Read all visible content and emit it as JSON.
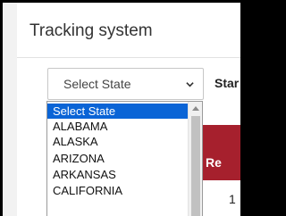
{
  "page": {
    "title": "Tracking system"
  },
  "state_select": {
    "value": "Select State",
    "options": [
      "Select State",
      "ALABAMA",
      "ALASKA",
      "ARIZONA",
      "ARKANSAS",
      "CALIFORNIA"
    ],
    "selected_index": 0
  },
  "toolbar": {
    "next_label_partial": "Star"
  },
  "table": {
    "header_partial": "Re",
    "first_cell": "1"
  },
  "colors": {
    "accent": "#a6202d",
    "selection": "#0a64d6"
  },
  "icons": {
    "select_chevron": "chevron-down-icon",
    "scroll_up": "scroll-up-arrow-icon"
  }
}
